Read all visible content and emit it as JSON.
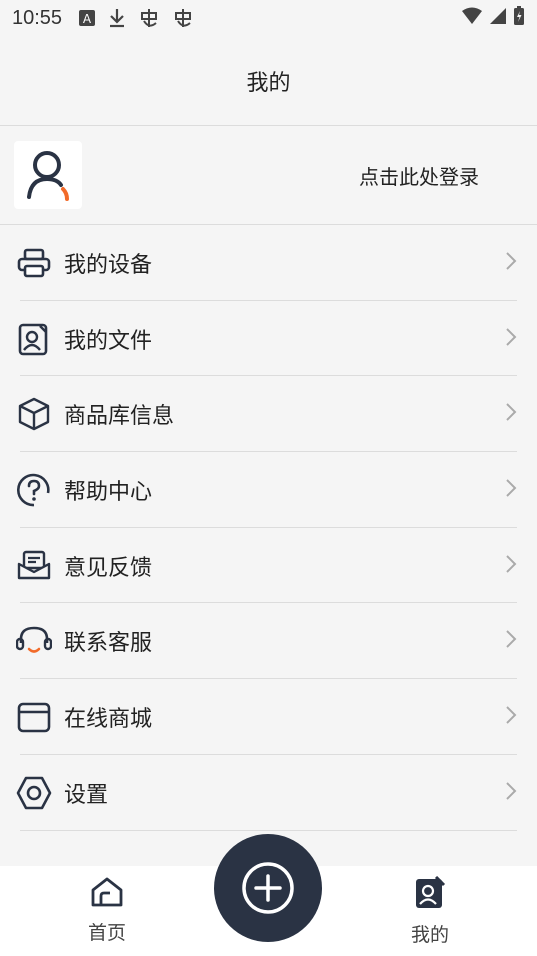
{
  "status_bar": {
    "time": "10:55"
  },
  "header": {
    "title": "我的"
  },
  "login": {
    "prompt": "点击此处登录"
  },
  "menu": {
    "items": [
      {
        "label": "我的设备",
        "icon": "printer-icon"
      },
      {
        "label": "我的文件",
        "icon": "file-user-icon"
      },
      {
        "label": "商品库信息",
        "icon": "box-icon"
      },
      {
        "label": "帮助中心",
        "icon": "help-icon"
      },
      {
        "label": "意见反馈",
        "icon": "feedback-icon"
      },
      {
        "label": "联系客服",
        "icon": "headset-icon"
      },
      {
        "label": "在线商城",
        "icon": "store-icon"
      },
      {
        "label": "设置",
        "icon": "settings-icon"
      }
    ]
  },
  "bottom_nav": {
    "home_label": "首页",
    "mine_label": "我的"
  },
  "colors": {
    "accent": "#f26b2a",
    "dark": "#2a3344",
    "background": "#f5f5f5"
  }
}
